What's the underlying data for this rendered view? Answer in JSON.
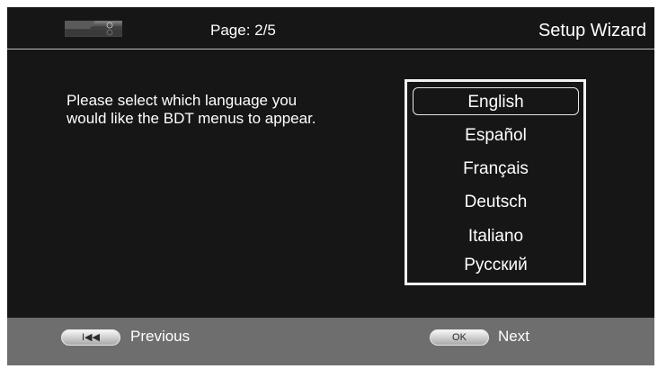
{
  "header": {
    "device_icon": "disc-player-icon",
    "page_indicator": "Page: 2/5",
    "title": "Setup Wizard"
  },
  "prompt": {
    "line1": "Please select which language you",
    "line2": "would like the BDT menus to appear."
  },
  "languages": {
    "selected": "English",
    "items": [
      "English",
      "Español",
      "Français",
      "Deutsch",
      "Italiano",
      "Русский"
    ]
  },
  "footer": {
    "previous": {
      "key_icon": "skip-back-icon",
      "key_label": "I◀◀",
      "label": "Previous"
    },
    "next": {
      "key_label": "OK",
      "label": "Next"
    }
  }
}
